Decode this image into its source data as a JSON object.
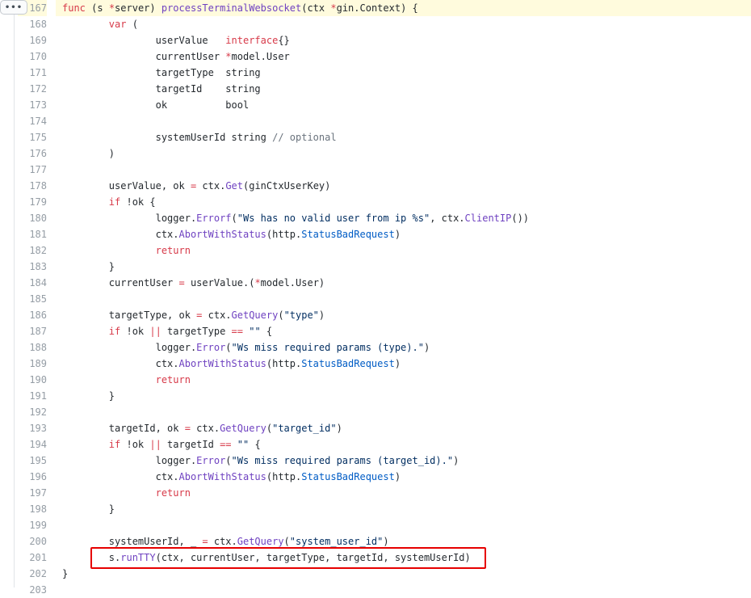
{
  "expand_button": {
    "label": "•••"
  },
  "lines": [
    {
      "n": "167",
      "hl": true,
      "t": [
        [
          "kw",
          "func"
        ],
        [
          "p",
          " (s "
        ],
        [
          "op",
          "*"
        ],
        [
          "p",
          "server) "
        ],
        [
          "fn",
          "processTerminalWebsocket"
        ],
        [
          "p",
          "(ctx "
        ],
        [
          "op",
          "*"
        ],
        [
          "p",
          "gin.Context) {"
        ]
      ]
    },
    {
      "n": "168",
      "t": [
        [
          "p",
          "        "
        ],
        [
          "kw",
          "var"
        ],
        [
          "p",
          " ("
        ]
      ]
    },
    {
      "n": "169",
      "t": [
        [
          "p",
          "                userValue   "
        ],
        [
          "kw",
          "interface"
        ],
        [
          "p",
          "{}"
        ]
      ]
    },
    {
      "n": "170",
      "t": [
        [
          "p",
          "                currentUser "
        ],
        [
          "op",
          "*"
        ],
        [
          "p",
          "model.User"
        ]
      ]
    },
    {
      "n": "171",
      "t": [
        [
          "p",
          "                targetType  string"
        ]
      ]
    },
    {
      "n": "172",
      "t": [
        [
          "p",
          "                targetId    string"
        ]
      ]
    },
    {
      "n": "173",
      "t": [
        [
          "p",
          "                ok          bool"
        ]
      ]
    },
    {
      "n": "174",
      "t": []
    },
    {
      "n": "175",
      "t": [
        [
          "p",
          "                systemUserId string "
        ],
        [
          "cm",
          "// optional"
        ]
      ]
    },
    {
      "n": "176",
      "t": [
        [
          "p",
          "        )"
        ]
      ]
    },
    {
      "n": "177",
      "t": []
    },
    {
      "n": "178",
      "t": [
        [
          "p",
          "        userValue, ok "
        ],
        [
          "op",
          "="
        ],
        [
          "p",
          " ctx."
        ],
        [
          "fn",
          "Get"
        ],
        [
          "p",
          "(ginCtxUserKey)"
        ]
      ]
    },
    {
      "n": "179",
      "t": [
        [
          "p",
          "        "
        ],
        [
          "kw",
          "if"
        ],
        [
          "p",
          " !ok {"
        ]
      ]
    },
    {
      "n": "180",
      "t": [
        [
          "p",
          "                logger."
        ],
        [
          "fn",
          "Errorf"
        ],
        [
          "p",
          "("
        ],
        [
          "str",
          "\"Ws has no valid user from ip %s\""
        ],
        [
          "p",
          ", ctx."
        ],
        [
          "fn",
          "ClientIP"
        ],
        [
          "p",
          "())"
        ]
      ]
    },
    {
      "n": "181",
      "t": [
        [
          "p",
          "                ctx."
        ],
        [
          "fn",
          "AbortWithStatus"
        ],
        [
          "p",
          "(http."
        ],
        [
          "con",
          "StatusBadRequest"
        ],
        [
          "p",
          ")"
        ]
      ]
    },
    {
      "n": "182",
      "t": [
        [
          "p",
          "                "
        ],
        [
          "kw",
          "return"
        ]
      ]
    },
    {
      "n": "183",
      "t": [
        [
          "p",
          "        }"
        ]
      ]
    },
    {
      "n": "184",
      "t": [
        [
          "p",
          "        currentUser "
        ],
        [
          "op",
          "="
        ],
        [
          "p",
          " userValue.("
        ],
        [
          "op",
          "*"
        ],
        [
          "p",
          "model.User)"
        ]
      ]
    },
    {
      "n": "185",
      "t": []
    },
    {
      "n": "186",
      "t": [
        [
          "p",
          "        targetType, ok "
        ],
        [
          "op",
          "="
        ],
        [
          "p",
          " ctx."
        ],
        [
          "fn",
          "GetQuery"
        ],
        [
          "p",
          "("
        ],
        [
          "str",
          "\"type\""
        ],
        [
          "p",
          ")"
        ]
      ]
    },
    {
      "n": "187",
      "t": [
        [
          "p",
          "        "
        ],
        [
          "kw",
          "if"
        ],
        [
          "p",
          " !ok "
        ],
        [
          "op",
          "||"
        ],
        [
          "p",
          " targetType "
        ],
        [
          "op",
          "=="
        ],
        [
          "p",
          " "
        ],
        [
          "str",
          "\"\""
        ],
        [
          "p",
          " {"
        ]
      ]
    },
    {
      "n": "188",
      "t": [
        [
          "p",
          "                logger."
        ],
        [
          "fn",
          "Error"
        ],
        [
          "p",
          "("
        ],
        [
          "str",
          "\"Ws miss required params (type).\""
        ],
        [
          "p",
          ")"
        ]
      ]
    },
    {
      "n": "189",
      "t": [
        [
          "p",
          "                ctx."
        ],
        [
          "fn",
          "AbortWithStatus"
        ],
        [
          "p",
          "(http."
        ],
        [
          "con",
          "StatusBadRequest"
        ],
        [
          "p",
          ")"
        ]
      ]
    },
    {
      "n": "190",
      "t": [
        [
          "p",
          "                "
        ],
        [
          "kw",
          "return"
        ]
      ]
    },
    {
      "n": "191",
      "t": [
        [
          "p",
          "        }"
        ]
      ]
    },
    {
      "n": "192",
      "t": []
    },
    {
      "n": "193",
      "t": [
        [
          "p",
          "        targetId, ok "
        ],
        [
          "op",
          "="
        ],
        [
          "p",
          " ctx."
        ],
        [
          "fn",
          "GetQuery"
        ],
        [
          "p",
          "("
        ],
        [
          "str",
          "\"target_id\""
        ],
        [
          "p",
          ")"
        ]
      ]
    },
    {
      "n": "194",
      "t": [
        [
          "p",
          "        "
        ],
        [
          "kw",
          "if"
        ],
        [
          "p",
          " !ok "
        ],
        [
          "op",
          "||"
        ],
        [
          "p",
          " targetId "
        ],
        [
          "op",
          "=="
        ],
        [
          "p",
          " "
        ],
        [
          "str",
          "\"\""
        ],
        [
          "p",
          " {"
        ]
      ]
    },
    {
      "n": "195",
      "t": [
        [
          "p",
          "                logger."
        ],
        [
          "fn",
          "Error"
        ],
        [
          "p",
          "("
        ],
        [
          "str",
          "\"Ws miss required params (target_id).\""
        ],
        [
          "p",
          ")"
        ]
      ]
    },
    {
      "n": "196",
      "t": [
        [
          "p",
          "                ctx."
        ],
        [
          "fn",
          "AbortWithStatus"
        ],
        [
          "p",
          "(http."
        ],
        [
          "con",
          "StatusBadRequest"
        ],
        [
          "p",
          ")"
        ]
      ]
    },
    {
      "n": "197",
      "t": [
        [
          "p",
          "                "
        ],
        [
          "kw",
          "return"
        ]
      ]
    },
    {
      "n": "198",
      "t": [
        [
          "p",
          "        }"
        ]
      ]
    },
    {
      "n": "199",
      "t": []
    },
    {
      "n": "200",
      "t": [
        [
          "p",
          "        systemUserId, _ "
        ],
        [
          "op",
          "="
        ],
        [
          "p",
          " ctx."
        ],
        [
          "fn",
          "GetQuery"
        ],
        [
          "p",
          "("
        ],
        [
          "str",
          "\"system_user_id\""
        ],
        [
          "p",
          ")"
        ]
      ]
    },
    {
      "n": "201",
      "t": [
        [
          "p",
          "        s."
        ],
        [
          "fn",
          "runTTY"
        ],
        [
          "p",
          "(ctx, currentUser, targetType, targetId, systemUserId)"
        ]
      ]
    },
    {
      "n": "202",
      "t": [
        [
          "p",
          "}"
        ]
      ]
    },
    {
      "n": "203",
      "t": []
    }
  ],
  "colors": {
    "keyword": "#d73a49",
    "function": "#6f42c1",
    "string": "#032f62",
    "comment": "#6a737d",
    "constant": "#005cc5",
    "highlight_box": "#e60000"
  }
}
